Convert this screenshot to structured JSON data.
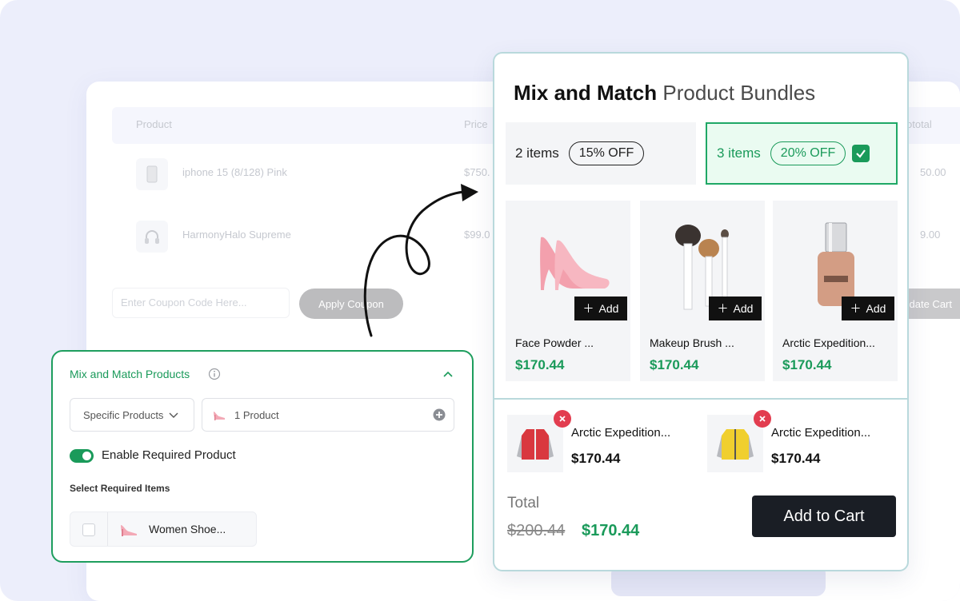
{
  "cart": {
    "headers": {
      "product": "Product",
      "price": "Price",
      "subtotal": "ototal"
    },
    "rows": [
      {
        "name": "iphone 15 (8/128) Pink",
        "price": "$750.",
        "subtotal": "50.00"
      },
      {
        "name": "HarmonyHalo Supreme",
        "price": "$99.0",
        "subtotal": "9.00"
      }
    ],
    "coupon_placeholder": "Enter Coupon Code Here...",
    "apply_label": "Apply Coupon",
    "update_label": "date Cart"
  },
  "settings": {
    "title": "Mix and Match Products",
    "filter_select": "Specific Products",
    "product_field": "1 Product",
    "toggle_label": "Enable Required Product",
    "section_label": "Select Required Items",
    "required_item": "Women Shoe..."
  },
  "bundle": {
    "title_bold": "Mix and Match",
    "title_rest": "Product Bundles",
    "tiers": [
      {
        "label": "2 items",
        "badge": "15% OFF",
        "selected": false
      },
      {
        "label": "3 items",
        "badge": "20% OFF",
        "selected": true
      }
    ],
    "products": [
      {
        "name": "Face Powder ...",
        "price": "$170.44",
        "add": "Add",
        "icon": "pink-heel-shoe"
      },
      {
        "name": "Makeup Brush ...",
        "price": "$170.44",
        "add": "Add",
        "icon": "makeup-brushes"
      },
      {
        "name": "Arctic Expedition...",
        "price": "$170.44",
        "add": "Add",
        "icon": "foundation-bottle"
      }
    ],
    "selected": [
      {
        "name": "Arctic Expedition...",
        "price": "$170.44",
        "icon": "red-jacket"
      },
      {
        "name": "Arctic Expedition...",
        "price": "$170.44",
        "icon": "yellow-jacket"
      }
    ],
    "total_label": "Total",
    "old_total": "$200.44",
    "new_total": "$170.44",
    "cart_button": "Add to Cart"
  },
  "colors": {
    "accent": "#1a9a5a",
    "remove": "#e23d4f",
    "dark": "#1a1e25"
  }
}
